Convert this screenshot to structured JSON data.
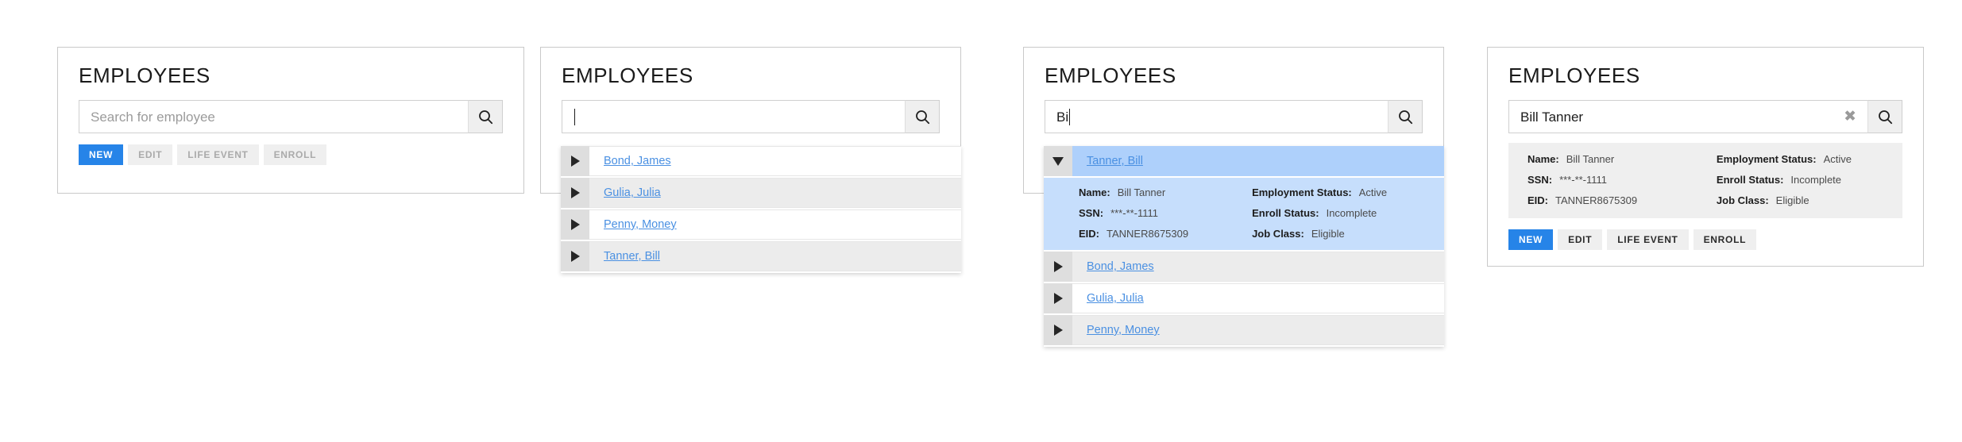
{
  "panels": [
    {
      "id": "panel-empty-search",
      "title": "EMPLOYEES",
      "search": {
        "value": "",
        "placeholder": "Search for employee",
        "search_icon": "magnifier-icon",
        "clear_icon": "clear-x-icon",
        "caret_visible": false
      },
      "buttons": [
        {
          "label": "NEW",
          "state": "primary"
        },
        {
          "label": "EDIT",
          "state": "disabled"
        },
        {
          "label": "LIFE EVENT",
          "state": "disabled"
        },
        {
          "label": "ENROLL",
          "state": "disabled"
        }
      ]
    },
    {
      "id": "panel-open-dropdown",
      "title": "EMPLOYEES",
      "search": {
        "value": "",
        "placeholder": "",
        "search_icon": "magnifier-icon",
        "caret_visible": true
      },
      "options": [
        {
          "label": "Bond, James",
          "expanded": false,
          "selected": false,
          "shade": "white",
          "toggle_icon": "triangle-right-icon"
        },
        {
          "label": "Gulia, Julia",
          "expanded": false,
          "selected": false,
          "shade": "gray",
          "toggle_icon": "triangle-right-icon"
        },
        {
          "label": "Penny, Money",
          "expanded": false,
          "selected": false,
          "shade": "white",
          "toggle_icon": "triangle-right-icon"
        },
        {
          "label": "Tanner, Bill",
          "expanded": false,
          "selected": false,
          "shade": "gray",
          "toggle_icon": "triangle-right-icon"
        }
      ]
    },
    {
      "id": "panel-filtered-expanded",
      "title": "EMPLOYEES",
      "search": {
        "value": "Bi",
        "placeholder": "",
        "search_icon": "magnifier-icon",
        "caret_visible": true
      },
      "options": [
        {
          "label": "Tanner, Bill",
          "expanded": true,
          "selected": true,
          "shade": "selected",
          "toggle_icon": "triangle-down-icon"
        },
        {
          "label": "Bond, James",
          "expanded": false,
          "selected": false,
          "shade": "gray",
          "toggle_icon": "triangle-right-icon"
        },
        {
          "label": "Gulia, Julia",
          "expanded": false,
          "selected": false,
          "shade": "white",
          "toggle_icon": "triangle-right-icon"
        },
        {
          "label": "Penny, Money",
          "expanded": false,
          "selected": false,
          "shade": "gray",
          "toggle_icon": "triangle-right-icon"
        }
      ],
      "detail": {
        "left": [
          {
            "key": "Name:",
            "value": "Bill Tanner"
          },
          {
            "key": "SSN:",
            "value": "***-**-1111"
          },
          {
            "key": "EID:",
            "value": "TANNER8675309"
          }
        ],
        "right": [
          {
            "key": "Employment Status:",
            "value": "Active"
          },
          {
            "key": "Enroll Status:",
            "value": "Incomplete"
          },
          {
            "key": "Job Class:",
            "value": "Eligible"
          }
        ]
      }
    },
    {
      "id": "panel-selected-employee",
      "title": "EMPLOYEES",
      "search": {
        "value": "Bill Tanner",
        "placeholder": "",
        "search_icon": "magnifier-icon",
        "clear_icon": "clear-x-icon",
        "show_clear": true,
        "caret_visible": false
      },
      "detail": {
        "left": [
          {
            "key": "Name:",
            "value": "Bill Tanner"
          },
          {
            "key": "SSN:",
            "value": "***-**-1111"
          },
          {
            "key": "EID:",
            "value": "TANNER8675309"
          }
        ],
        "right": [
          {
            "key": "Employment Status:",
            "value": "Active"
          },
          {
            "key": "Enroll Status:",
            "value": "Incomplete"
          },
          {
            "key": "Job Class:",
            "value": "Eligible"
          }
        ]
      },
      "buttons": [
        {
          "label": "NEW",
          "state": "primary"
        },
        {
          "label": "EDIT",
          "state": "enabled"
        },
        {
          "label": "LIFE EVENT",
          "state": "enabled"
        },
        {
          "label": "ENROLL",
          "state": "enabled"
        }
      ]
    }
  ],
  "colors": {
    "accent_blue": "#2684e8",
    "link_blue": "#4a90e2",
    "selected_row": "#aed0fb",
    "detail_selected_bg": "#c6defc",
    "row_alt": "#ececec",
    "toggle_cell": "#dedede",
    "button_bg": "#efefef",
    "border": "#c9c9c9"
  }
}
